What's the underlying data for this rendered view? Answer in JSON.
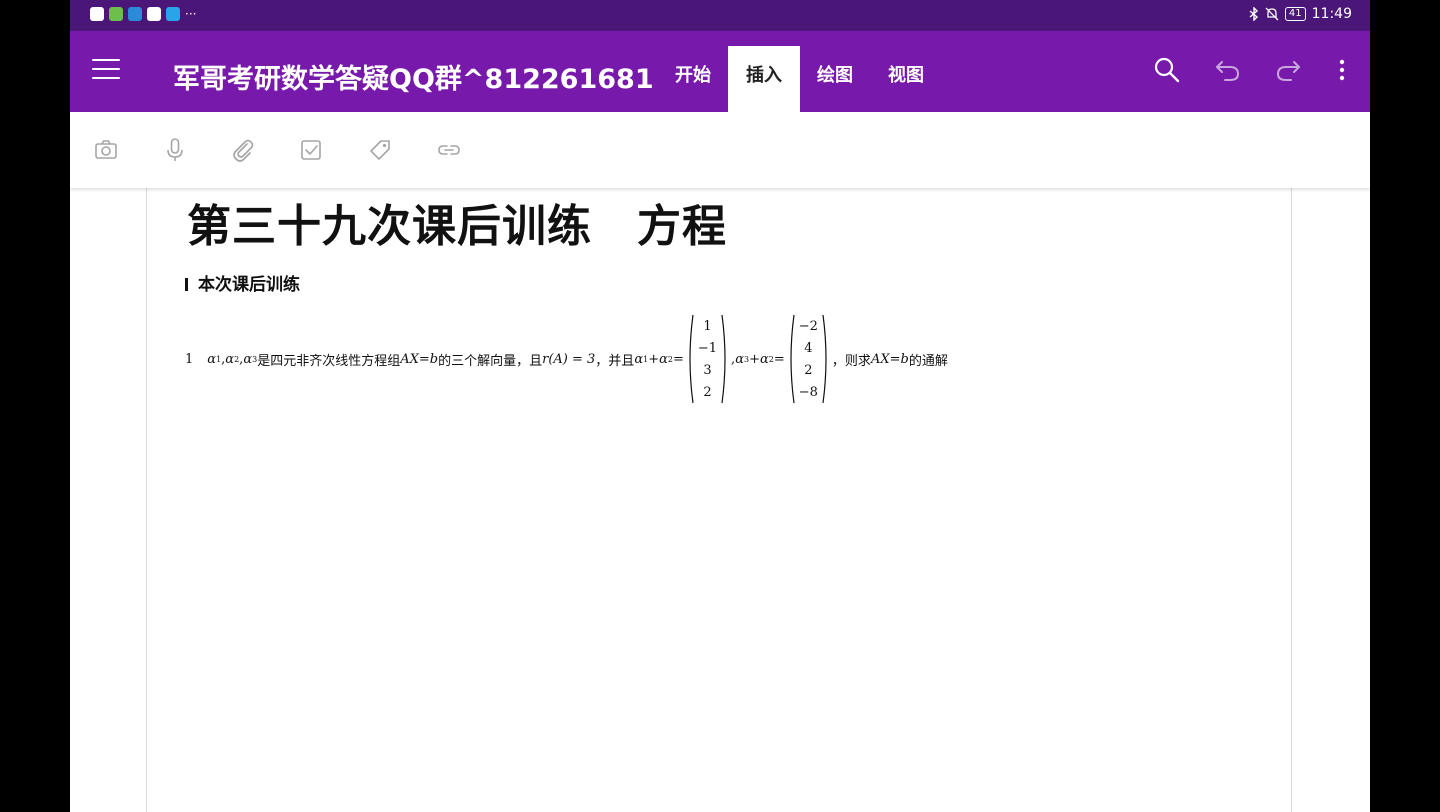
{
  "status_bar": {
    "time": "11:49",
    "battery": "41",
    "more": "···",
    "app_icon_colors": [
      "#ffffff",
      "#6cbf4b",
      "#2a8bd8",
      "#ffffff",
      "#2aa4e8"
    ]
  },
  "app_bar": {
    "notebook_title": "军哥考研数学答疑QQ群^812261681",
    "tabs": [
      {
        "label": "开始"
      },
      {
        "label": "插入"
      },
      {
        "label": "绘图"
      },
      {
        "label": "视图"
      }
    ],
    "active_tab": "插入",
    "accent_color": "#7719aa",
    "actions": [
      "search-icon",
      "undo-icon",
      "redo-icon",
      "more-vertical-icon"
    ]
  },
  "ribbon": {
    "tools": [
      "camera-icon",
      "microphone-icon",
      "paperclip-icon",
      "checkbox-icon",
      "tag-icon",
      "link-icon"
    ]
  },
  "page": {
    "title": "第三十九次课后训练　方程",
    "section_heading": "本次课后训练",
    "problem": {
      "number": "1",
      "a": "α",
      "sub1": "1",
      "sub2": "2",
      "sub3": "3",
      "comma": ",",
      "text1": "是四元非齐次线性方程组",
      "ax": "AX",
      "eq_b": " = ",
      "b": "b",
      "text2": "的三个解向量，且",
      "rank": "r(A) = 3",
      "text3": "，并且",
      "plus": "+",
      "equals": "=",
      "vector1": [
        "1",
        "−1",
        "3",
        "2"
      ],
      "vector2": [
        "−2",
        "4",
        "2",
        "−8"
      ],
      "text4": "，则求",
      "text5": "的通解"
    }
  }
}
